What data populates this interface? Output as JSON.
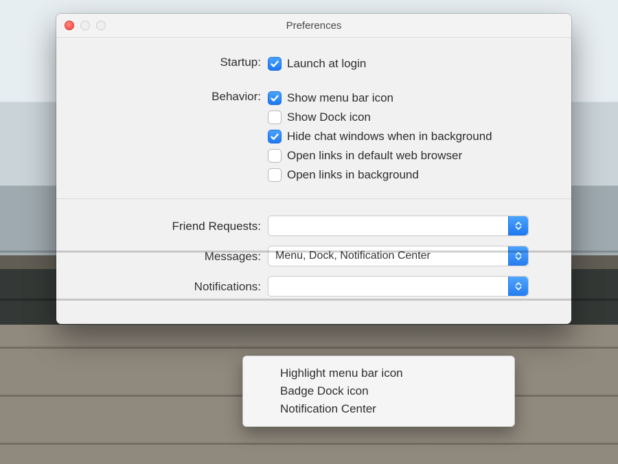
{
  "window": {
    "title": "Preferences"
  },
  "groups": {
    "startup": {
      "label": "Startup:",
      "options": {
        "launch_at_login": "Launch at login"
      }
    },
    "behavior": {
      "label": "Behavior:",
      "options": {
        "menu_bar_icon": "Show menu bar icon",
        "dock_icon": "Show Dock icon",
        "hide_chat_bg": "Hide chat windows when in background",
        "open_links_default": "Open links in default web browser",
        "open_links_bg": "Open links in background"
      }
    },
    "friend_requests": {
      "label": "Friend Requests:",
      "value": ""
    },
    "messages": {
      "label": "Messages:",
      "value": "Menu, Dock, Notification Center"
    },
    "notifications": {
      "label": "Notifications:",
      "value": ""
    }
  },
  "dropdown": {
    "items": {
      "highlight_menu": "Highlight menu bar icon",
      "badge_dock": "Badge Dock icon",
      "notification_center": "Notification Center"
    }
  }
}
